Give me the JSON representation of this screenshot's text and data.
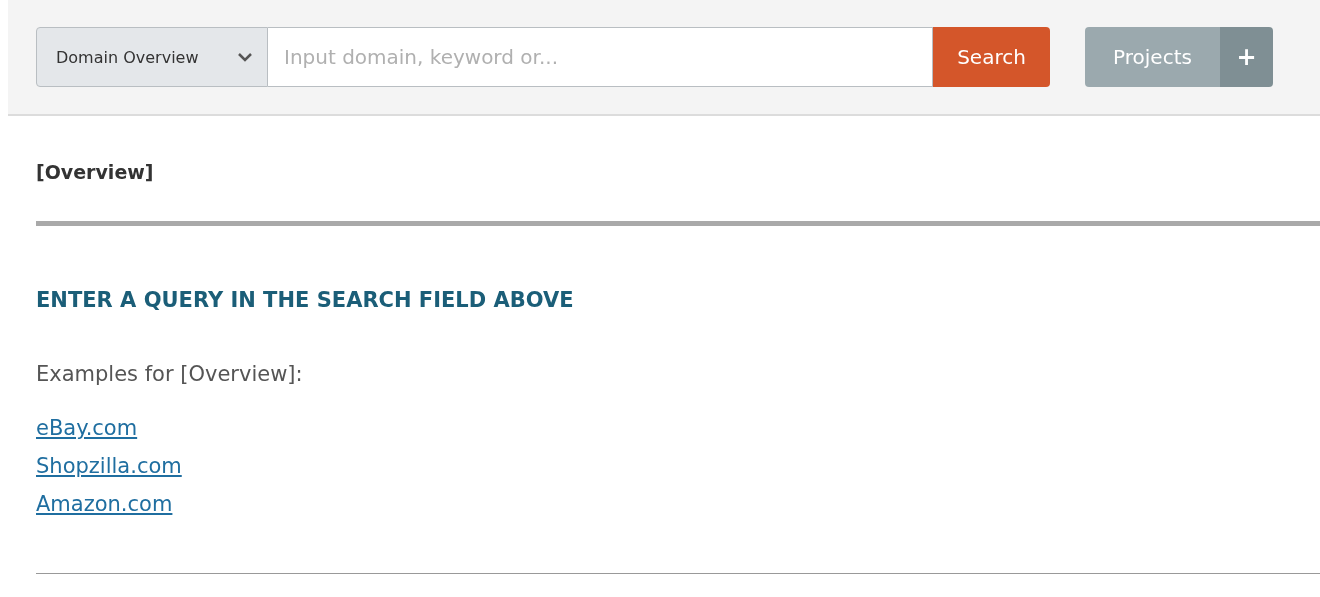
{
  "search_bar": {
    "mode_dropdown": "Domain Overview",
    "query": {
      "placeholder": "Input domain, keyword or..."
    },
    "search_button": "Search",
    "projects_button": "Projects",
    "add_button": "+"
  },
  "section_title": "[Overview]",
  "heading": "ENTER A QUERY IN THE SEARCH FIELD ABOVE",
  "examples_label": "Examples for [Overview]:",
  "examples": [
    "eBay.com",
    "Shopzilla.com",
    "Amazon.com"
  ]
}
